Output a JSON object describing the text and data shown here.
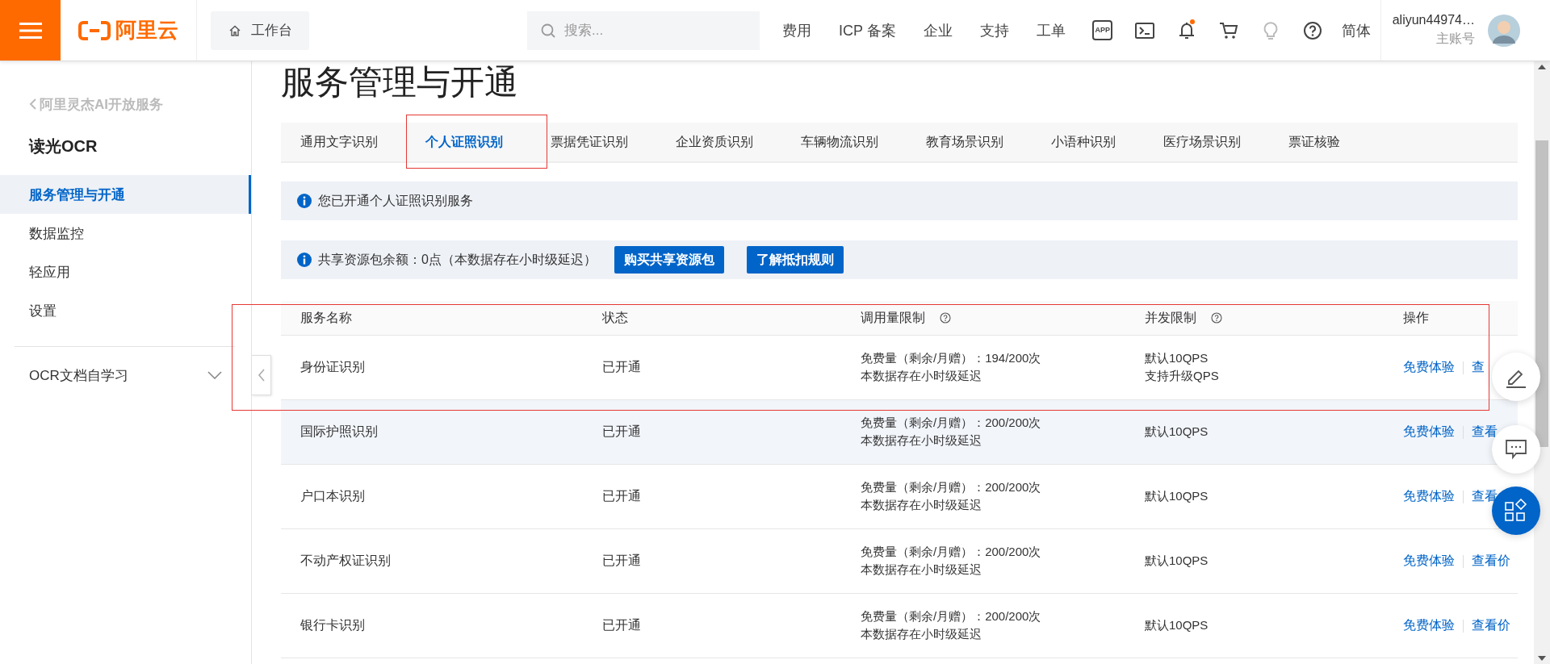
{
  "header": {
    "brand": "阿里云",
    "workbench": "工作台",
    "search": {
      "placeholder": "搜索..."
    },
    "nav": [
      "费用",
      "ICP 备案",
      "企业",
      "支持",
      "工单"
    ],
    "app_icon_label": "APP",
    "notification_dot": true,
    "language": "简体",
    "user": {
      "name": "aliyun44974…",
      "role": "主账号"
    }
  },
  "sidebar": {
    "back": "阿里灵杰AI开放服务",
    "title": "读光OCR",
    "items": [
      {
        "label": "服务管理与开通",
        "selected": true
      },
      {
        "label": "数据监控",
        "selected": false
      },
      {
        "label": "轻应用",
        "selected": false
      },
      {
        "label": "设置",
        "selected": false
      }
    ],
    "groups": [
      {
        "label": "OCR文档自学习",
        "expanded": false
      }
    ]
  },
  "page_title": "服务管理与开通",
  "tabs": [
    {
      "label": "通用文字识别",
      "selected": false,
      "highlighted": false
    },
    {
      "label": "个人证照识别",
      "selected": true,
      "highlighted": true
    },
    {
      "label": "票据凭证识别",
      "selected": false,
      "highlighted": false
    },
    {
      "label": "企业资质识别",
      "selected": false,
      "highlighted": false
    },
    {
      "label": "车辆物流识别",
      "selected": false,
      "highlighted": false
    },
    {
      "label": "教育场景识别",
      "selected": false,
      "highlighted": false
    },
    {
      "label": "小语种识别",
      "selected": false,
      "highlighted": false
    },
    {
      "label": "医疗场景识别",
      "selected": false,
      "highlighted": false
    },
    {
      "label": "票证核验",
      "selected": false,
      "highlighted": false
    }
  ],
  "notices": [
    {
      "text": "您已开通个人证照识别服务"
    },
    {
      "text": "共享资源包余额：0点（本数据存在小时级延迟）",
      "buttons": [
        "购买共享资源包",
        "了解抵扣规则"
      ]
    }
  ],
  "table": {
    "columns": [
      {
        "label": "服务名称",
        "help": false
      },
      {
        "label": "状态",
        "help": false
      },
      {
        "label": "调用量限制",
        "help": true
      },
      {
        "label": "并发限制",
        "help": true
      },
      {
        "label": "操作",
        "help": false
      }
    ],
    "rows": [
      {
        "name": "身份证识别",
        "status": "已开通",
        "quota": [
          "免费量（剩余/月赠）：194/200次",
          "本数据存在小时级延迟"
        ],
        "concurrency": [
          "默认10QPS",
          "支持升级QPS"
        ],
        "actions": [
          "免费体验",
          "查"
        ],
        "highlighted": true,
        "hovered": false
      },
      {
        "name": "国际护照识别",
        "status": "已开通",
        "quota": [
          "免费量（剩余/月赠）：200/200次",
          "本数据存在小时级延迟"
        ],
        "concurrency": [
          "默认10QPS"
        ],
        "actions": [
          "免费体验",
          "查看"
        ],
        "highlighted": false,
        "hovered": true
      },
      {
        "name": "户口本识别",
        "status": "已开通",
        "quota": [
          "免费量（剩余/月赠）：200/200次",
          "本数据存在小时级延迟"
        ],
        "concurrency": [
          "默认10QPS"
        ],
        "actions": [
          "免费体验",
          "查看"
        ],
        "highlighted": false,
        "hovered": false
      },
      {
        "name": "不动产权证识别",
        "status": "已开通",
        "quota": [
          "免费量（剩余/月赠）：200/200次",
          "本数据存在小时级延迟"
        ],
        "concurrency": [
          "默认10QPS"
        ],
        "actions": [
          "免费体验",
          "查看价"
        ],
        "highlighted": false,
        "hovered": false
      },
      {
        "name": "银行卡识别",
        "status": "已开通",
        "quota": [
          "免费量（剩余/月赠）：200/200次",
          "本数据存在小时级延迟"
        ],
        "concurrency": [
          "默认10QPS"
        ],
        "actions": [
          "免费体验",
          "查看价"
        ],
        "highlighted": false,
        "hovered": false
      }
    ]
  }
}
